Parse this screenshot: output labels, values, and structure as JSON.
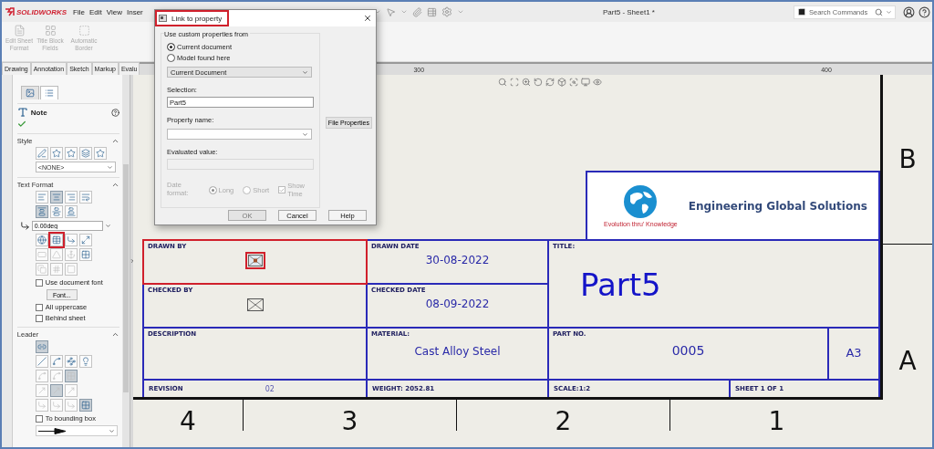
{
  "app": {
    "logo": "SOLIDWORKS",
    "menu": [
      "File",
      "Edit",
      "View",
      "Inser"
    ],
    "document_title": "Part5 - Sheet1 *",
    "search": {
      "placeholder": "Search Commands"
    }
  },
  "ribbon": [
    {
      "label": "Edit Sheet Format",
      "disabled": true
    },
    {
      "label": "Title Block Fields",
      "disabled": true
    },
    {
      "label": "Automatic Border",
      "disabled": true
    }
  ],
  "tabs": [
    {
      "label": "Drawing",
      "selected": false
    },
    {
      "label": "Annotation",
      "selected": false
    },
    {
      "label": "Sketch",
      "selected": false
    },
    {
      "label": "Markup",
      "selected": false
    },
    {
      "label": "Evalu",
      "selected": false
    }
  ],
  "ruler": [
    "300",
    "400"
  ],
  "property_manager": {
    "tabs": [
      {
        "selected": false
      },
      {
        "selected": true
      }
    ],
    "title": "Note",
    "style": {
      "title": "Style",
      "expanded": true,
      "tools": [
        {
          "disabled": false,
          "pressed": false
        },
        {
          "disabled": false,
          "pressed": false
        },
        {
          "disabled": false,
          "pressed": false
        },
        {
          "disabled": false,
          "pressed": false
        },
        {
          "disabled": false,
          "pressed": false
        }
      ],
      "select": "<NONE>"
    },
    "text_format": {
      "title": "Text Format",
      "expanded": true,
      "align_rows": [
        [
          {
            "disabled": false,
            "pressed": false
          },
          {
            "disabled": false,
            "pressed": true
          },
          {
            "disabled": false,
            "pressed": false
          },
          {
            "disabled": false,
            "pressed": false
          }
        ],
        [
          {
            "disabled": false,
            "pressed": true
          },
          {
            "disabled": false,
            "pressed": false
          },
          {
            "disabled": false,
            "pressed": false
          }
        ]
      ],
      "angle": "0.00deg",
      "tool_rows": [
        [
          {
            "disabled": false,
            "pressed": false,
            "highlighted": false
          },
          {
            "disabled": false,
            "pressed": false,
            "highlighted": true
          },
          {
            "disabled": false,
            "pressed": false,
            "highlighted": false
          },
          {
            "disabled": false,
            "pressed": false,
            "highlighted": false
          }
        ],
        [
          {
            "disabled": true,
            "pressed": false,
            "highlighted": false
          },
          {
            "disabled": true,
            "pressed": false,
            "highlighted": false
          },
          {
            "disabled": true,
            "pressed": false,
            "highlighted": false
          },
          {
            "disabled": false,
            "pressed": false,
            "highlighted": false
          }
        ],
        [
          {
            "disabled": true,
            "pressed": false,
            "highlighted": false
          },
          {
            "disabled": true,
            "pressed": false,
            "highlighted": false
          },
          {
            "disabled": true,
            "pressed": false,
            "highlighted": false
          }
        ]
      ],
      "checkboxes": [
        {
          "label": "Use document font",
          "checked": false
        },
        {
          "label": "All uppercase",
          "checked": false
        },
        {
          "label": "Behind sheet",
          "checked": false
        }
      ],
      "font_button": "Font..."
    },
    "leader": {
      "title": "Leader",
      "expanded": true,
      "tool_rows": [
        [
          {
            "disabled": false,
            "pressed": true
          }
        ],
        [
          {
            "disabled": false,
            "pressed": false
          },
          {
            "disabled": false,
            "pressed": false
          },
          {
            "disabled": false,
            "pressed": false
          },
          {
            "disabled": false,
            "pressed": false
          }
        ],
        [
          {
            "disabled": true,
            "pressed": false
          },
          {
            "disabled": true,
            "pressed": false
          },
          {
            "disabled": true,
            "pressed": true
          }
        ],
        [
          {
            "disabled": true,
            "pressed": false
          },
          {
            "disabled": true,
            "pressed": true
          },
          {
            "disabled": true,
            "pressed": false
          }
        ],
        [
          {
            "disabled": true,
            "pressed": false
          },
          {
            "disabled": true,
            "pressed": false
          },
          {
            "disabled": true,
            "pressed": false
          },
          {
            "disabled": false,
            "pressed": true
          }
        ]
      ],
      "checkbox": {
        "label": "To bounding box",
        "checked": false
      }
    }
  },
  "dialog": {
    "title": "Link to property",
    "title_highlighted": true,
    "group_label": "Use custom properties from",
    "sources": [
      {
        "label": "Current document",
        "selected": true
      },
      {
        "label": "Model found here",
        "selected": false
      }
    ],
    "source_select": "Current Document",
    "selection": {
      "label": "Selection:",
      "value": "Part5"
    },
    "file_properties_button": "File Properties",
    "property_name": {
      "label": "Property name:"
    },
    "evaluated_value": {
      "label": "Evaluated value:",
      "disabled": true
    },
    "date_format": {
      "label": "Date format:",
      "disabled": true,
      "options": [
        {
          "label": "Long",
          "selected": true
        },
        {
          "label": "Short",
          "selected": false
        }
      ],
      "show_time": {
        "label": "Show Time",
        "checked": true
      }
    },
    "buttons": [
      {
        "label": "OK",
        "disabled": true
      },
      {
        "label": "Cancel",
        "disabled": false
      },
      {
        "label": "Help",
        "disabled": false
      }
    ]
  },
  "drawing": {
    "zone_rows": [
      "B",
      "A"
    ],
    "zone_columns": [
      "4",
      "3",
      "2",
      "1"
    ],
    "logo": {
      "company": "Engineering Global Solutions",
      "tagline": "Evolution thru' Knowledge"
    },
    "title_block": {
      "drawn_by": {
        "label": "DRAWN BY",
        "highlighted": true
      },
      "drawn_date": {
        "label": "DRAWN DATE",
        "value": "30-08-2022"
      },
      "checked_by": {
        "label": "CHECKED BY",
        "highlighted": false
      },
      "checked_date": {
        "label": "CHECKED DATE",
        "value": "08-09-2022"
      },
      "title": {
        "label": "TITLE:",
        "value": "Part5"
      },
      "description": {
        "label": "DESCRIPTION"
      },
      "material": {
        "label": "MATERIAL:",
        "value": "Cast Alloy Steel"
      },
      "part_no": {
        "label": "PART NO.",
        "value": "0005"
      },
      "size": "A3",
      "revision": {
        "label": "REVISION",
        "value": "02"
      },
      "weight": "WEIGHT: 2052.81",
      "scale": "SCALE:1:2",
      "sheet": "SHEET 1 OF 1"
    }
  }
}
